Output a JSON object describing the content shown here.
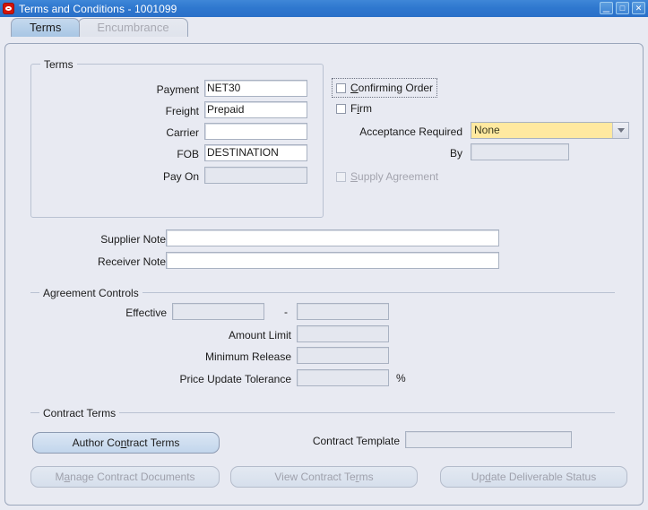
{
  "window": {
    "title": "Terms and Conditions - 1001099",
    "logo_icon": "oracle-logo-icon",
    "minimize_label": "_",
    "maximize_label": "□",
    "close_label": "✕",
    "accent_color": "#2f78cf",
    "background_color": "#e8eaf2"
  },
  "tabs": [
    {
      "label": "Terms",
      "state": "active"
    },
    {
      "label": "Encumbrance",
      "state": "disabled"
    }
  ],
  "terms_group": {
    "title": "Terms",
    "fields": [
      {
        "label": "Payment",
        "value": "NET30",
        "state": "enabled"
      },
      {
        "label": "Freight",
        "value": "Prepaid",
        "state": "enabled"
      },
      {
        "label": "Carrier",
        "value": "",
        "state": "enabled"
      },
      {
        "label": "FOB",
        "value": "DESTINATION",
        "state": "enabled"
      },
      {
        "label": "Pay On",
        "value": "",
        "state": "disabled"
      }
    ]
  },
  "options": {
    "confirming_order": {
      "label": "Confirming Order",
      "mnemonic": "C",
      "checked": false,
      "state": "enabled",
      "focused": true
    },
    "firm": {
      "label": "Firm",
      "mnemonic": "i",
      "checked": false,
      "state": "enabled",
      "focused": false
    },
    "acceptance_required": {
      "label": "Acceptance Required",
      "value": "None",
      "options": [
        "None"
      ],
      "arrow_icon": "chevron-down-icon",
      "highlight_color": "#ffe9a0"
    },
    "by": {
      "label": "By",
      "value": "",
      "state": "disabled"
    },
    "supply_agreement": {
      "label": "Supply Agreement",
      "mnemonic": "S",
      "checked": false,
      "state": "disabled"
    }
  },
  "notes": {
    "supplier_note": {
      "label": "Supplier Note",
      "value": "",
      "state": "enabled"
    },
    "receiver_note": {
      "label": "Receiver Note",
      "value": "",
      "state": "enabled"
    }
  },
  "agreement_controls": {
    "title": "Agreement Controls",
    "effective": {
      "label": "Effective",
      "separator": "-",
      "from_value": "",
      "to_value": "",
      "state": "disabled"
    },
    "amount_limit": {
      "label": "Amount Limit",
      "value": "",
      "state": "disabled"
    },
    "minimum_release": {
      "label": "Minimum Release",
      "value": "",
      "state": "disabled"
    },
    "price_update_tolerance": {
      "label": "Price Update Tolerance",
      "value": "",
      "state": "disabled",
      "suffix": "%"
    }
  },
  "contract_terms": {
    "title": "Contract Terms",
    "contract_template": {
      "label": "Contract Template",
      "value": "",
      "state": "disabled"
    },
    "buttons": [
      {
        "label_before": "Author Co",
        "mnemonic": "n",
        "label_after": "tract Terms",
        "state": "enabled"
      },
      {
        "label_before": "M",
        "mnemonic": "a",
        "label_after": "nage Contract Documents",
        "state": "disabled"
      },
      {
        "label_before": "View Contract Te",
        "mnemonic": "r",
        "label_after": "ms",
        "state": "disabled"
      },
      {
        "label_before": "Up",
        "mnemonic": "d",
        "label_after": "ate Deliverable Status",
        "state": "disabled"
      }
    ]
  }
}
